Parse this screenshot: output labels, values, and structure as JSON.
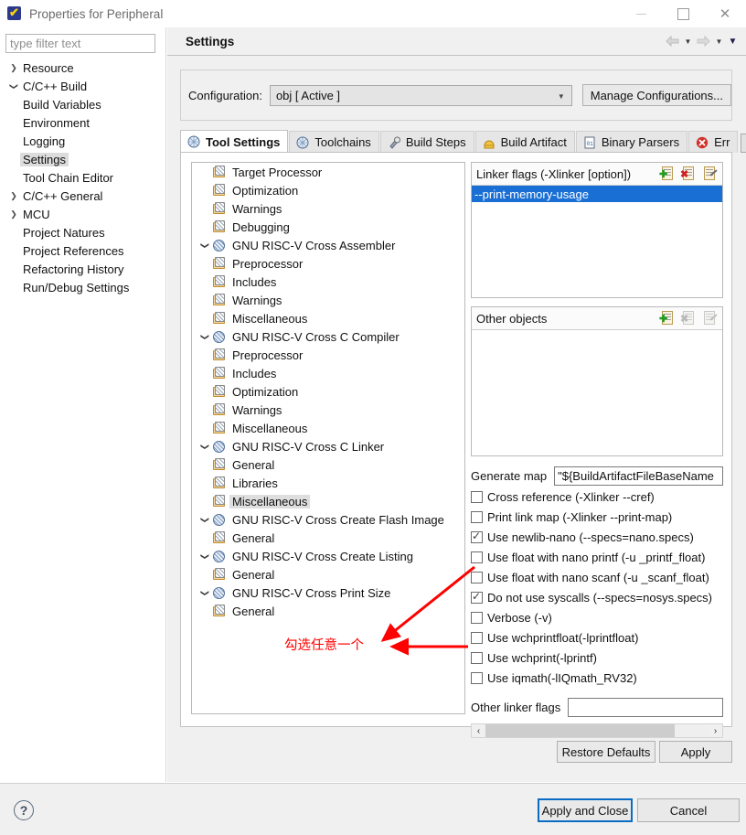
{
  "window": {
    "title": "Properties for Peripheral",
    "icon": "eclipse-shield-icon",
    "minimize": "minimize-icon",
    "maximize": "maximize-icon",
    "close": "✕"
  },
  "left": {
    "filter_placeholder": "type filter text",
    "filter_value": "",
    "tree": [
      {
        "label": "Resource",
        "indent": 0,
        "arrow": "collapsed",
        "selected": false
      },
      {
        "label": "C/C++ Build",
        "indent": 0,
        "arrow": "expanded",
        "selected": false
      },
      {
        "label": "Build Variables",
        "indent": 1,
        "arrow": "none",
        "selected": false
      },
      {
        "label": "Environment",
        "indent": 1,
        "arrow": "none",
        "selected": false
      },
      {
        "label": "Logging",
        "indent": 1,
        "arrow": "none",
        "selected": false
      },
      {
        "label": "Settings",
        "indent": 1,
        "arrow": "none",
        "selected": true
      },
      {
        "label": "Tool Chain Editor",
        "indent": 1,
        "arrow": "none",
        "selected": false
      },
      {
        "label": "C/C++ General",
        "indent": 0,
        "arrow": "collapsed",
        "selected": false
      },
      {
        "label": "MCU",
        "indent": 0,
        "arrow": "collapsed",
        "selected": false
      },
      {
        "label": "Project Natures",
        "indent": 0,
        "arrow": "none",
        "selected": false
      },
      {
        "label": "Project References",
        "indent": 0,
        "arrow": "none",
        "selected": false
      },
      {
        "label": "Refactoring History",
        "indent": 0,
        "arrow": "none",
        "selected": false
      },
      {
        "label": "Run/Debug Settings",
        "indent": 0,
        "arrow": "none",
        "selected": false
      }
    ]
  },
  "page": {
    "title": "Settings",
    "nav_back": "back-arrow-icon",
    "nav_forward": "forward-arrow-icon",
    "nav_menu": "chevron-down-icon"
  },
  "configuration": {
    "label": "Configuration:",
    "value": "obj  [ Active ]",
    "manage_button": "Manage Configurations..."
  },
  "tabs": [
    {
      "label": "Tool Settings",
      "icon": "tool-settings-icon",
      "active": true
    },
    {
      "label": "Toolchains",
      "icon": "toolchains-icon",
      "active": false
    },
    {
      "label": "Build Steps",
      "icon": "build-steps-icon",
      "active": false
    },
    {
      "label": "Build Artifact",
      "icon": "build-artifact-icon",
      "active": false
    },
    {
      "label": "Binary Parsers",
      "icon": "binary-parsers-icon",
      "active": false
    },
    {
      "label": "Err",
      "icon": "error-parsers-icon",
      "active": false
    }
  ],
  "tab_scroll": {
    "left": "◄",
    "right": "►"
  },
  "tool_tree": [
    {
      "label": "Target Processor",
      "indent": 1,
      "arrow": "none",
      "icon": "tool-leaf-icon",
      "selected": false
    },
    {
      "label": "Optimization",
      "indent": 1,
      "arrow": "none",
      "icon": "tool-leaf-icon",
      "selected": false
    },
    {
      "label": "Warnings",
      "indent": 1,
      "arrow": "none",
      "icon": "tool-leaf-icon",
      "selected": false
    },
    {
      "label": "Debugging",
      "indent": 1,
      "arrow": "none",
      "icon": "tool-leaf-icon",
      "selected": false
    },
    {
      "label": "GNU RISC-V Cross Assembler",
      "indent": 0,
      "arrow": "expanded",
      "icon": "tool-category-icon",
      "selected": false
    },
    {
      "label": "Preprocessor",
      "indent": 1,
      "arrow": "none",
      "icon": "tool-leaf-icon",
      "selected": false
    },
    {
      "label": "Includes",
      "indent": 1,
      "arrow": "none",
      "icon": "tool-leaf-icon",
      "selected": false
    },
    {
      "label": "Warnings",
      "indent": 1,
      "arrow": "none",
      "icon": "tool-leaf-icon",
      "selected": false
    },
    {
      "label": "Miscellaneous",
      "indent": 1,
      "arrow": "none",
      "icon": "tool-leaf-icon",
      "selected": false
    },
    {
      "label": "GNU RISC-V Cross C Compiler",
      "indent": 0,
      "arrow": "expanded",
      "icon": "tool-category-icon",
      "selected": false
    },
    {
      "label": "Preprocessor",
      "indent": 1,
      "arrow": "none",
      "icon": "tool-leaf-icon",
      "selected": false
    },
    {
      "label": "Includes",
      "indent": 1,
      "arrow": "none",
      "icon": "tool-leaf-icon",
      "selected": false
    },
    {
      "label": "Optimization",
      "indent": 1,
      "arrow": "none",
      "icon": "tool-leaf-icon",
      "selected": false
    },
    {
      "label": "Warnings",
      "indent": 1,
      "arrow": "none",
      "icon": "tool-leaf-icon",
      "selected": false
    },
    {
      "label": "Miscellaneous",
      "indent": 1,
      "arrow": "none",
      "icon": "tool-leaf-icon",
      "selected": false
    },
    {
      "label": "GNU RISC-V Cross C Linker",
      "indent": 0,
      "arrow": "expanded",
      "icon": "tool-category-icon",
      "selected": false
    },
    {
      "label": "General",
      "indent": 1,
      "arrow": "none",
      "icon": "tool-leaf-icon",
      "selected": false
    },
    {
      "label": "Libraries",
      "indent": 1,
      "arrow": "none",
      "icon": "tool-leaf-icon",
      "selected": false
    },
    {
      "label": "Miscellaneous",
      "indent": 1,
      "arrow": "none",
      "icon": "tool-leaf-icon",
      "selected": true
    },
    {
      "label": "GNU RISC-V Cross Create Flash Image",
      "indent": 0,
      "arrow": "expanded",
      "icon": "tool-category-icon",
      "selected": false
    },
    {
      "label": "General",
      "indent": 1,
      "arrow": "none",
      "icon": "tool-leaf-icon",
      "selected": false
    },
    {
      "label": "GNU RISC-V Cross Create Listing",
      "indent": 0,
      "arrow": "expanded",
      "icon": "tool-category-icon",
      "selected": false
    },
    {
      "label": "General",
      "indent": 1,
      "arrow": "none",
      "icon": "tool-leaf-icon",
      "selected": false
    },
    {
      "label": "GNU RISC-V Cross Print Size",
      "indent": 0,
      "arrow": "expanded",
      "icon": "tool-category-icon",
      "selected": false
    },
    {
      "label": "General",
      "indent": 1,
      "arrow": "none",
      "icon": "tool-leaf-icon",
      "selected": false
    }
  ],
  "linker_flags": {
    "title": "Linker flags (-Xlinker [option])",
    "add_icon": "add-icon",
    "delete_icon": "delete-icon",
    "edit_icon": "edit-icon",
    "items": [
      "--print-memory-usage"
    ],
    "selected_index": 0
  },
  "other_objects": {
    "title": "Other objects",
    "add_icon": "add-icon",
    "delete_icon": "delete-icon",
    "edit_icon": "edit-icon",
    "items": []
  },
  "generate_map": {
    "label": "Generate map",
    "value": "\"${BuildArtifactFileBaseName"
  },
  "checkboxes": [
    {
      "label": "Cross reference (-Xlinker --cref)",
      "checked": false
    },
    {
      "label": "Print link map (-Xlinker --print-map)",
      "checked": false
    },
    {
      "label": "Use newlib-nano (--specs=nano.specs)",
      "checked": true
    },
    {
      "label": "Use float with nano printf (-u _printf_float)",
      "checked": false
    },
    {
      "label": "Use float with nano scanf (-u _scanf_float)",
      "checked": false
    },
    {
      "label": "Do not use syscalls (--specs=nosys.specs)",
      "checked": true
    },
    {
      "label": "Verbose (-v)",
      "checked": false
    },
    {
      "label": "Use wchprintfloat(-lprintfloat)",
      "checked": false
    },
    {
      "label": "Use wchprint(-lprintf)",
      "checked": false
    },
    {
      "label": "Use iqmath(-lIQmath_RV32)",
      "checked": false
    }
  ],
  "other_linker_flags": {
    "label": "Other linker flags",
    "value": ""
  },
  "hscroll": {
    "left": "‹",
    "right": "›"
  },
  "buttons": {
    "restore_defaults": "Restore Defaults",
    "apply": "Apply",
    "apply_and_close": "Apply and Close",
    "cancel": "Cancel",
    "help": "?"
  },
  "annotations": {
    "note": "勾选任意一个",
    "color": "#ff0000"
  }
}
